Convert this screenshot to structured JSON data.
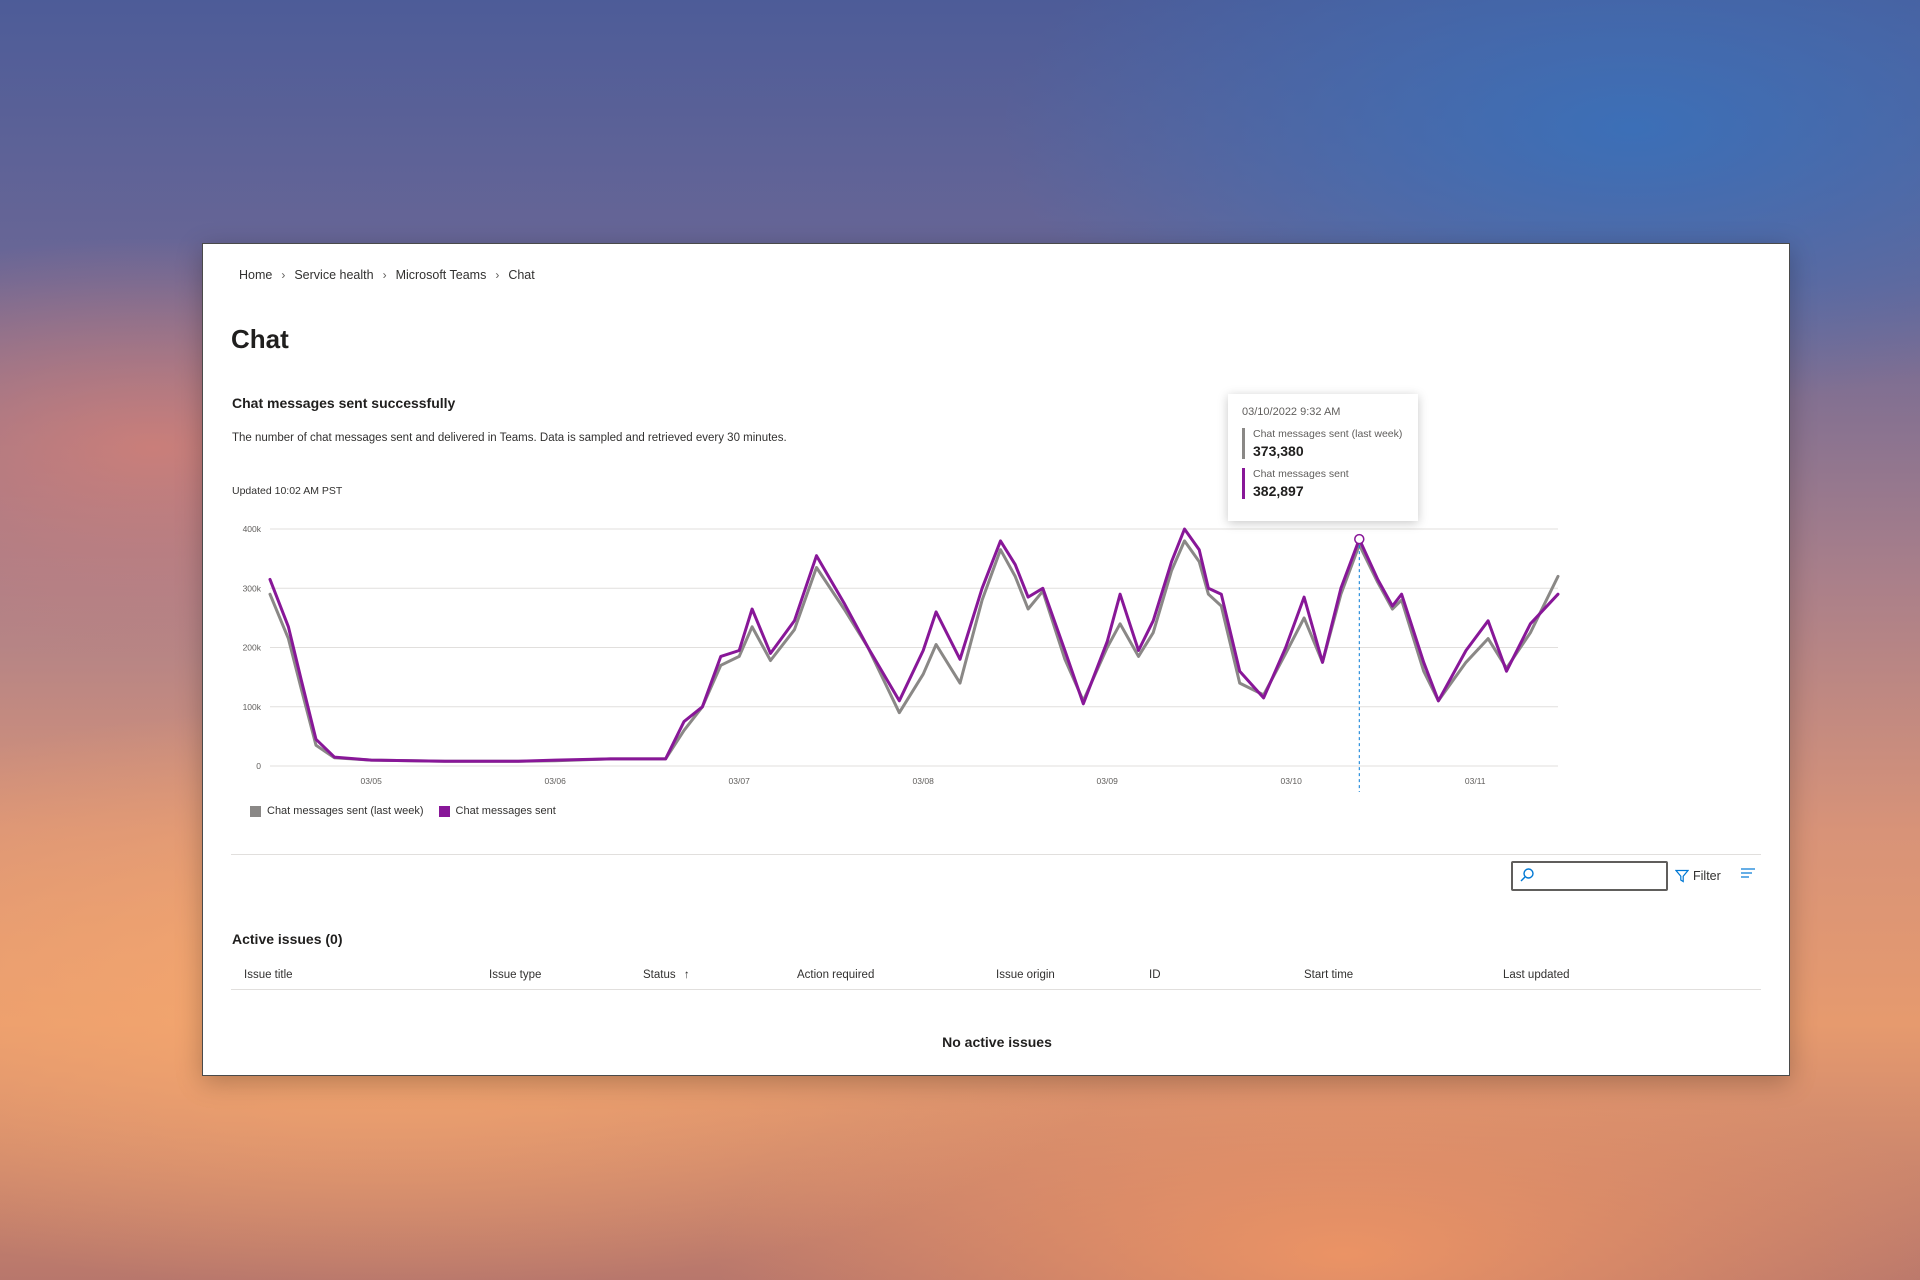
{
  "breadcrumb": [
    "Home",
    "Service health",
    "Microsoft Teams",
    "Chat"
  ],
  "page_title": "Chat",
  "card": {
    "title": "Chat messages sent successfully",
    "description": "The number of chat messages sent and delivered in Teams. Data is sampled and retrieved every 30 minutes.",
    "updated": "Updated 10:02 AM PST"
  },
  "tooltip": {
    "date": "03/10/2022 9:32 AM",
    "rows": [
      {
        "label": "Chat messages sent (last week)",
        "value": "373,380"
      },
      {
        "label": "Chat messages sent",
        "value": "382,897"
      }
    ]
  },
  "legend": [
    "Chat messages sent (last week)",
    "Chat messages sent"
  ],
  "colors": {
    "last_week": "#8a8886",
    "current": "#881798",
    "grid": "#e1dfdd",
    "accent": "#0078d4"
  },
  "chart_data": {
    "type": "line",
    "title": "Chat messages sent successfully",
    "x_ticks": [
      "03/05",
      "03/06",
      "03/07",
      "03/08",
      "03/09",
      "03/10",
      "03/11"
    ],
    "y_ticks": [
      "0",
      "100k",
      "200k",
      "300k",
      "400k"
    ],
    "ylim": [
      0,
      400000
    ],
    "xlim_days": [
      4.45,
      11.45
    ],
    "grid": true,
    "legend_position": "bottom-left",
    "series": [
      {
        "name": "Chat messages sent (last week)",
        "points": [
          [
            4.45,
            290000
          ],
          [
            4.55,
            215000
          ],
          [
            4.62,
            130000
          ],
          [
            4.7,
            35000
          ],
          [
            4.8,
            14000
          ],
          [
            5.0,
            10000
          ],
          [
            5.4,
            8000
          ],
          [
            5.8,
            8000
          ],
          [
            6.0,
            9000
          ],
          [
            6.3,
            12000
          ],
          [
            6.6,
            12000
          ],
          [
            6.7,
            60000
          ],
          [
            6.8,
            100000
          ],
          [
            6.9,
            170000
          ],
          [
            7.0,
            185000
          ],
          [
            7.07,
            235000
          ],
          [
            7.17,
            178000
          ],
          [
            7.3,
            230000
          ],
          [
            7.42,
            335000
          ],
          [
            7.57,
            265000
          ],
          [
            7.7,
            200000
          ],
          [
            7.87,
            90000
          ],
          [
            8.0,
            155000
          ],
          [
            8.07,
            205000
          ],
          [
            8.2,
            140000
          ],
          [
            8.32,
            280000
          ],
          [
            8.42,
            365000
          ],
          [
            8.5,
            320000
          ],
          [
            8.57,
            265000
          ],
          [
            8.65,
            295000
          ],
          [
            8.77,
            180000
          ],
          [
            8.87,
            110000
          ],
          [
            9.0,
            200000
          ],
          [
            9.07,
            240000
          ],
          [
            9.17,
            185000
          ],
          [
            9.25,
            225000
          ],
          [
            9.35,
            330000
          ],
          [
            9.42,
            380000
          ],
          [
            9.5,
            345000
          ],
          [
            9.55,
            290000
          ],
          [
            9.62,
            270000
          ],
          [
            9.72,
            140000
          ],
          [
            9.85,
            120000
          ],
          [
            9.97,
            190000
          ],
          [
            10.07,
            250000
          ],
          [
            10.17,
            175000
          ],
          [
            10.27,
            290000
          ],
          [
            10.37,
            373380
          ],
          [
            10.47,
            310000
          ],
          [
            10.55,
            265000
          ],
          [
            10.6,
            280000
          ],
          [
            10.72,
            160000
          ],
          [
            10.8,
            110000
          ],
          [
            10.95,
            175000
          ],
          [
            11.07,
            215000
          ],
          [
            11.17,
            165000
          ],
          [
            11.3,
            225000
          ],
          [
            11.45,
            320000
          ]
        ]
      },
      {
        "name": "Chat messages sent",
        "points": [
          [
            4.45,
            315000
          ],
          [
            4.55,
            235000
          ],
          [
            4.62,
            145000
          ],
          [
            4.7,
            45000
          ],
          [
            4.8,
            15000
          ],
          [
            5.0,
            10000
          ],
          [
            5.4,
            8000
          ],
          [
            5.8,
            8000
          ],
          [
            6.0,
            10000
          ],
          [
            6.3,
            12000
          ],
          [
            6.6,
            12000
          ],
          [
            6.7,
            75000
          ],
          [
            6.8,
            100000
          ],
          [
            6.9,
            185000
          ],
          [
            7.0,
            195000
          ],
          [
            7.07,
            265000
          ],
          [
            7.17,
            190000
          ],
          [
            7.3,
            245000
          ],
          [
            7.42,
            355000
          ],
          [
            7.57,
            275000
          ],
          [
            7.7,
            200000
          ],
          [
            7.87,
            110000
          ],
          [
            8.0,
            195000
          ],
          [
            8.07,
            260000
          ],
          [
            8.2,
            180000
          ],
          [
            8.32,
            300000
          ],
          [
            8.42,
            380000
          ],
          [
            8.5,
            340000
          ],
          [
            8.57,
            285000
          ],
          [
            8.65,
            300000
          ],
          [
            8.77,
            195000
          ],
          [
            8.87,
            105000
          ],
          [
            9.0,
            210000
          ],
          [
            9.07,
            290000
          ],
          [
            9.17,
            195000
          ],
          [
            9.25,
            245000
          ],
          [
            9.35,
            345000
          ],
          [
            9.42,
            400000
          ],
          [
            9.5,
            365000
          ],
          [
            9.55,
            300000
          ],
          [
            9.62,
            290000
          ],
          [
            9.72,
            160000
          ],
          [
            9.85,
            115000
          ],
          [
            9.97,
            200000
          ],
          [
            10.07,
            285000
          ],
          [
            10.17,
            175000
          ],
          [
            10.27,
            300000
          ],
          [
            10.37,
            382897
          ],
          [
            10.47,
            315000
          ],
          [
            10.55,
            270000
          ],
          [
            10.6,
            290000
          ],
          [
            10.72,
            175000
          ],
          [
            10.8,
            110000
          ],
          [
            10.95,
            195000
          ],
          [
            11.07,
            245000
          ],
          [
            11.17,
            160000
          ],
          [
            11.3,
            240000
          ],
          [
            11.45,
            290000
          ]
        ]
      }
    ],
    "hover_x": 10.37
  },
  "toolbar": {
    "search_placeholder": "",
    "filter_label": "Filter"
  },
  "issues": {
    "title": "Active issues (0)",
    "columns": [
      "Issue title",
      "Issue type",
      "Status",
      "Action required",
      "Issue origin",
      "ID",
      "Start time",
      "Last updated"
    ],
    "empty_text": "No active issues"
  }
}
